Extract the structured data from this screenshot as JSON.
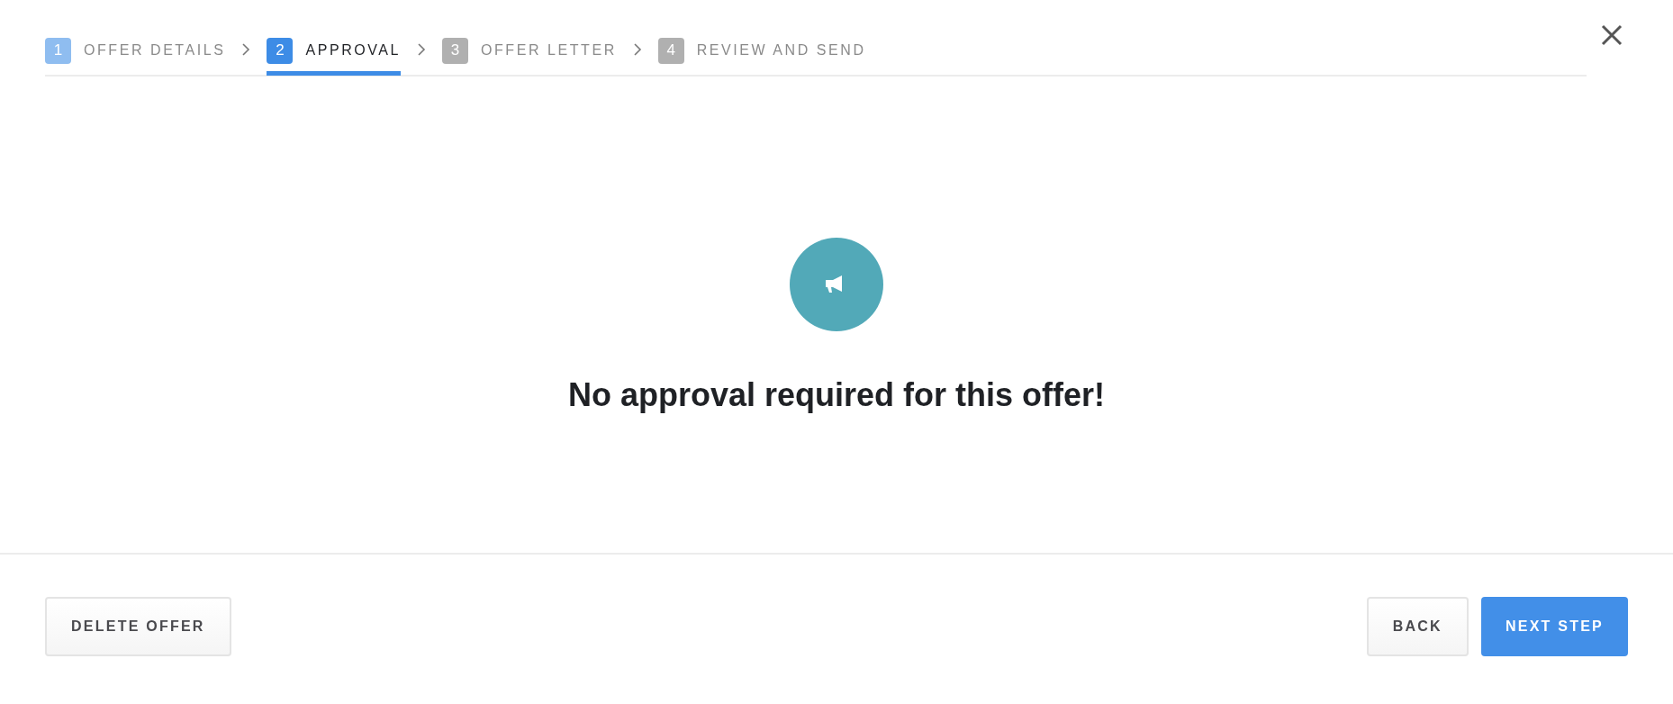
{
  "steps": [
    {
      "number": "1",
      "label": "OFFER DETAILS",
      "selected": false,
      "kind": "done"
    },
    {
      "number": "2",
      "label": "APPROVAL",
      "selected": true,
      "kind": "current"
    },
    {
      "number": "3",
      "label": "OFFER LETTER",
      "selected": false,
      "kind": "todo"
    },
    {
      "number": "4",
      "label": "REVIEW AND SEND",
      "selected": false,
      "kind": "todo"
    }
  ],
  "message": "No approval required for this offer!",
  "footer": {
    "left_buttons": [
      {
        "label": "DELETE OFFER"
      }
    ],
    "right_buttons": [
      {
        "label": "BACK",
        "kind": "secondary"
      },
      {
        "label": "NEXT STEP",
        "kind": "primary"
      }
    ]
  }
}
